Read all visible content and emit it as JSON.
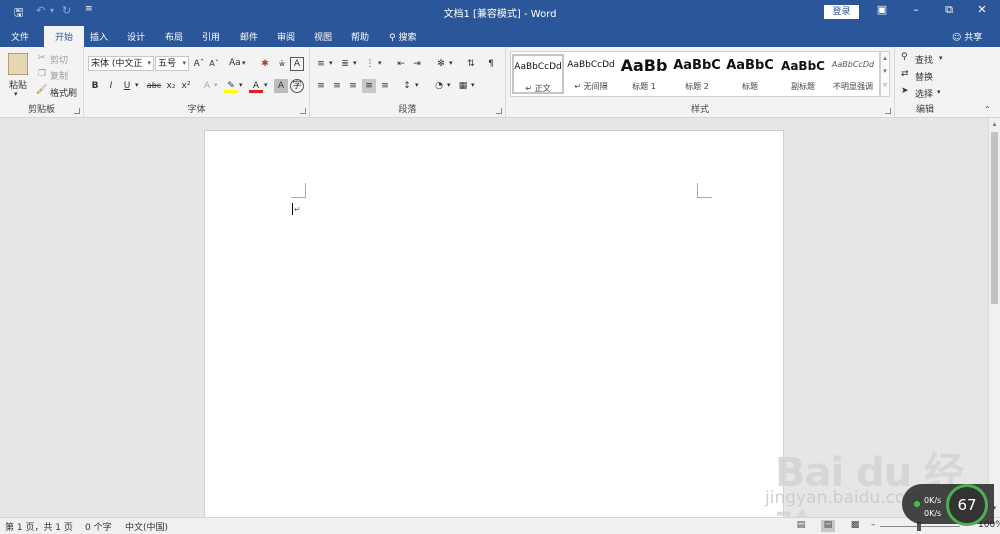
{
  "title_bar": {
    "title": "文档1 [兼容模式] - Word",
    "sign_in": "登录",
    "save_icon": "save-icon",
    "undo_icon": "undo-icon",
    "redo_icon": "redo-icon",
    "customize_icon": "customize-quick-access-icon"
  },
  "tabs": [
    {
      "label": "文件"
    },
    {
      "label": "开始"
    },
    {
      "label": "插入"
    },
    {
      "label": "设计"
    },
    {
      "label": "布局"
    },
    {
      "label": "引用"
    },
    {
      "label": "邮件"
    },
    {
      "label": "审阅"
    },
    {
      "label": "视图"
    },
    {
      "label": "帮助"
    }
  ],
  "search_label": "搜索",
  "share_label": "共享",
  "clipboard": {
    "paste": "粘贴",
    "cut": "剪切",
    "copy": "复制",
    "format_painter": "格式刷",
    "group_label": "剪贴板"
  },
  "font": {
    "font_name": "宋体 (中文正",
    "font_size": "五号",
    "change_case": "Aa",
    "bold": "B",
    "italic": "I",
    "underline": "U",
    "strikethrough": "abc",
    "subscript": "x₂",
    "superscript": "x²",
    "group_label": "字体"
  },
  "paragraph": {
    "group_label": "段落"
  },
  "styles": {
    "items": [
      {
        "sample": "AaBbCcDd",
        "name": "正文"
      },
      {
        "sample": "AaBbCcDd",
        "name": "无间隔"
      },
      {
        "sample": "AaBb",
        "name": "标题 1"
      },
      {
        "sample": "AaBbC",
        "name": "标题 2"
      },
      {
        "sample": "AaBbC",
        "name": "标题"
      },
      {
        "sample": "AaBbC",
        "name": "副标题"
      },
      {
        "sample": "AaBbCcDd",
        "name": "不明显强调"
      }
    ],
    "group_label": "样式"
  },
  "editing": {
    "find": "查找",
    "replace": "替换",
    "select": "选择",
    "group_label": "编辑"
  },
  "status_bar": {
    "page": "第 1 页，共 1 页",
    "words": "0 个字",
    "language": "中文(中国)",
    "zoom": "100%"
  },
  "watermark": {
    "main": "Bai du 经验",
    "sub": "jingyan.baidu.com"
  },
  "speed_widget": {
    "up": "0K/s",
    "down": "0K/s",
    "value": "67"
  }
}
